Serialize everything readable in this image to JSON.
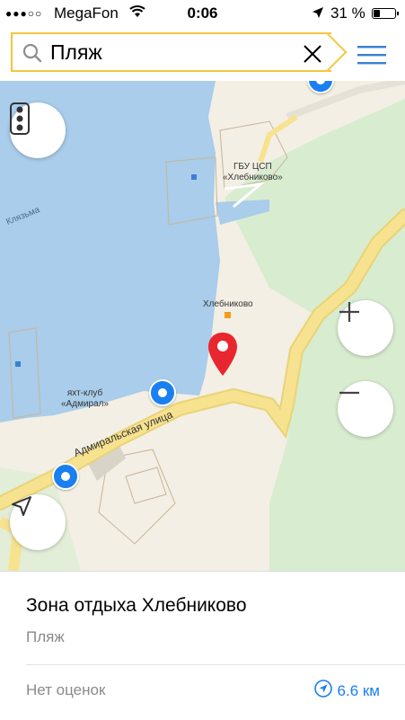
{
  "status_bar": {
    "signal": "●●●○○",
    "carrier": "MegaFon",
    "time": "0:06",
    "battery": "31 %"
  },
  "search": {
    "query": "Пляж"
  },
  "map": {
    "labels": {
      "gbu": "ГБУ ЦСП\n«Хлебниково»",
      "river": "Клязьма",
      "village": "Хлебниково",
      "yacht_club": "яхт-клуб\n«Адмирал»",
      "street": "Адмиральская улица"
    }
  },
  "place_card": {
    "title": "Зона отдыха Хлебниково",
    "category": "Пляж",
    "rating": "Нет оценок",
    "distance": "6.6 км"
  },
  "colors": {
    "water": "#a9cdea",
    "green": "#d8ecd0",
    "road": "#f7e28f",
    "accent": "#1a7ff0",
    "pin": "#e8262e",
    "search_border": "#f5c63c"
  }
}
